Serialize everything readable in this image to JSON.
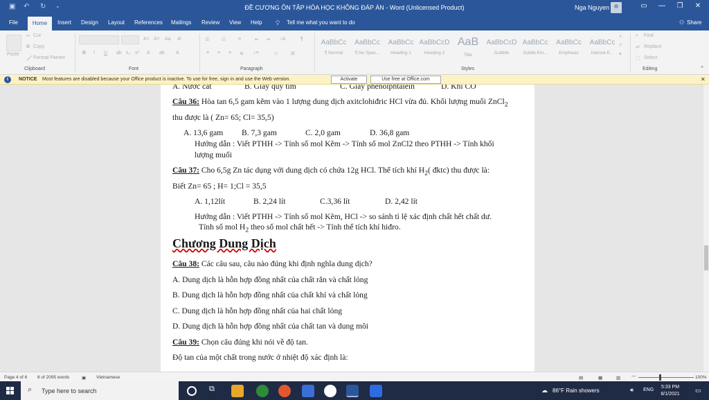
{
  "window": {
    "title": "ĐỀ CƯƠNG ÔN TẬP HÓA HỌC KHÔNG ĐÁP ÁN  -  Word (Unlicensed Product)",
    "user": "Nga Nguyen"
  },
  "tabs": [
    "File",
    "Home",
    "Insert",
    "Design",
    "Layout",
    "References",
    "Mailings",
    "Review",
    "View",
    "Help"
  ],
  "tell_me": "Tell me what you want to do",
  "share": "Share",
  "ribbon": {
    "clipboard": {
      "label": "Clipboard",
      "paste": "Paste",
      "cut": "Cut",
      "copy": "Copy",
      "format_painter": "Format Painter"
    },
    "font": {
      "label": "Font"
    },
    "paragraph": {
      "label": "Paragraph"
    },
    "styles": {
      "label": "Styles",
      "items": [
        {
          "sample": "AaBbCc",
          "name": "¶ Normal"
        },
        {
          "sample": "AaBbCc",
          "name": "¶ No Spac..."
        },
        {
          "sample": "AaBbCc",
          "name": "Heading 1"
        },
        {
          "sample": "AaBbCcD",
          "name": "Heading 2"
        },
        {
          "sample": "AaB",
          "name": "Title"
        },
        {
          "sample": "AaBbCcD",
          "name": "Subtitle"
        },
        {
          "sample": "AaBbCc",
          "name": "Subtle Em..."
        },
        {
          "sample": "AaBbCc",
          "name": "Emphasis"
        },
        {
          "sample": "AaBbCc",
          "name": "Intense E..."
        }
      ]
    },
    "editing": {
      "label": "Editing",
      "find": "Find",
      "replace": "Replace",
      "select": "Select"
    }
  },
  "notice": {
    "title": "NOTICE",
    "message": "Most features are disabled because your Office product is inactive. To use for free, sign in and use the Web version.",
    "activate": "Activate",
    "use_free": "Use free at Office.com"
  },
  "document": {
    "partial_top": [
      "A. Nước cất",
      "B. Giấy quỳ tím",
      "C. Giấy phenolphtalein",
      "D. Khí CO"
    ],
    "q36_label": "Câu 36:",
    "q36_text": " Hòa tan 6,5 gam kẽm vào 1 lượng dung dịch axitclohiđric HCl vừa đủ. Khối lượng muối ZnCl",
    "q36_sub": "2",
    "q36_line2": "thu được là ( Zn= 65; Cl= 35,5)",
    "q36_answers": [
      "A. 13,6 gam",
      "B. 7,3 gam",
      "C. 2,0 gam",
      "D. 36,8 gam"
    ],
    "q36_hint1": "Hướng dẫn : Viết PTHH -> Tính số mol Kẽm ->  Tính số mol ZnCl2 theo PTHH -> Tính khối",
    "q36_hint2": "lượng muối",
    "q37_label": "Câu 37:",
    "q37_text_a": " Cho 6,5g Zn tác dụng với dung dịch có chứa 12g HCl. Thể tích khí H",
    "q37_sub": "2",
    "q37_text_b": "( đktc) thu được là:",
    "q37_line2": "Biết Zn= 65 ; H= 1;Cl = 35,5",
    "q37_answers": [
      "A. 1,12lít",
      "B. 2,24 lít",
      "C.3,36 lít",
      "D. 2,42 lít"
    ],
    "q37_hint1": "Hướng dẫn : Viết PTHH -> Tính số mol Kẽm, HCl -> so sánh tỉ lệ xác định chất hết chất dư.",
    "q37_hint2a": "Tính số mol H",
    "q37_hint2sub": "2",
    "q37_hint2b": " theo số mol chất hết -> Tính thể tích khí hiđro.",
    "chapter": "Chương Dung Dịch",
    "q38_label": "Câu 38:",
    "q38_text": " Các câu sau, câu nào đúng khi định nghĩa dung dịch?",
    "q38_answers": [
      "A. Dung dịch là hỗn hợp đồng nhất của chất rắn và chất lỏng",
      "B. Dung dịch là hỗn hợp đồng nhất của chất khí và chất lỏng",
      "C. Dung dịch là hỗn hợp đồng nhất của hai chất lỏng",
      "D. Dung dịch là hỗn hợp đồng nhất của chất tan và dung môi"
    ],
    "q39_label": "Câu 39:",
    "q39_text": " Chọn câu đúng khi nói về độ tan.",
    "q39_line2": "Độ tan của một chất trong nước ở nhiệt độ xác định là:"
  },
  "status": {
    "page": "Page 4 of 6",
    "words": "8 of 2095 words",
    "language": "Vietnamese",
    "zoom": "100%"
  },
  "taskbar": {
    "search": "Type here to search",
    "weather": "86°F  Rain showers",
    "lang": "ENG",
    "time": "5:33 PM",
    "date": "8/1/2021"
  },
  "colors": {
    "accent": "#2b579a",
    "notice_bg": "#fcf3c4",
    "taskbar": "#1f2a44"
  }
}
